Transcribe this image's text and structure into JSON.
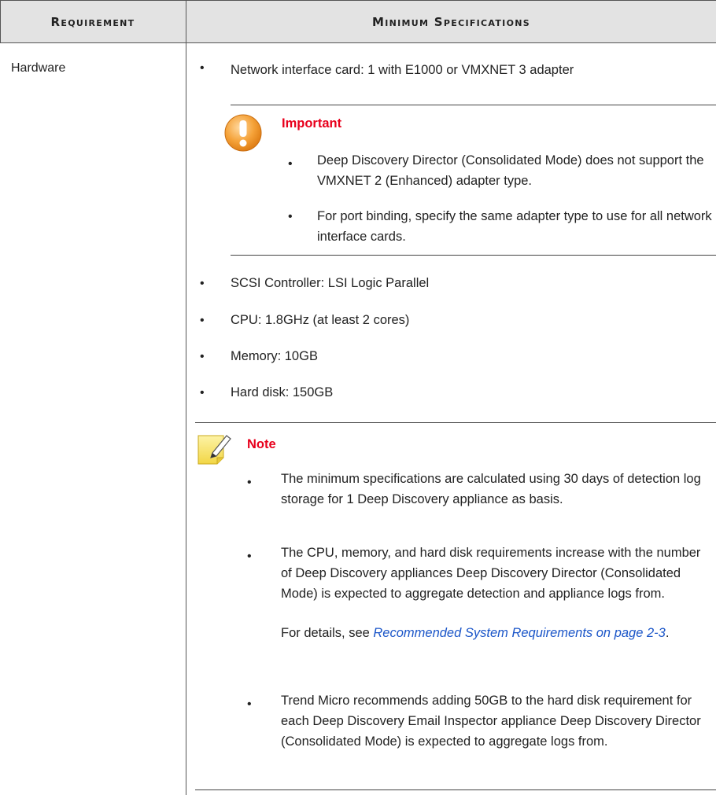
{
  "header": {
    "col1": "Requirement",
    "col2": "Minimum Specifications"
  },
  "row": {
    "requirement": "Hardware",
    "bullet1": "Network interface card: 1 with E1000 or VMXNET 3 adapter",
    "important": {
      "title": "Important",
      "items": [
        "Deep Discovery Director (Consolidated Mode) does not support the VMXNET 2 (Enhanced) adapter type.",
        "For port binding, specify the same adapter type to use for all network interface cards."
      ]
    },
    "bullets": [
      "SCSI Controller: LSI Logic Parallel",
      "CPU: 1.8GHz (at least 2 cores)",
      "Memory: 10GB",
      "Hard disk: 150GB"
    ],
    "note": {
      "title": "Note",
      "item1": "The minimum specifications are calculated using 30 days of detection log storage for 1 Deep Discovery appliance as basis.",
      "item2": "The CPU, memory, and hard disk requirements increase with the number of Deep Discovery appliances Deep Discovery Director (Consolidated Mode) is expected to aggregate detection and appliance logs from.",
      "details_prefix": "For details, see ",
      "details_link": "Recommended System Requirements on page 2-3",
      "details_suffix": ".",
      "item3": "Trend Micro recommends adding 50GB to the hard disk requirement for each Deep Discovery Email Inspector appliance Deep Discovery Director (Consolidated Mode) is expected to aggregate logs from."
    }
  },
  "icons": {
    "important": "warning-circle-icon",
    "note": "note-pencil-icon"
  },
  "colors": {
    "header_bg": "#e3e3e3",
    "important_title": "#e8001c",
    "important_icon": "#f5a33a",
    "note_icon": "#f7e168",
    "link": "#1a55c8"
  }
}
